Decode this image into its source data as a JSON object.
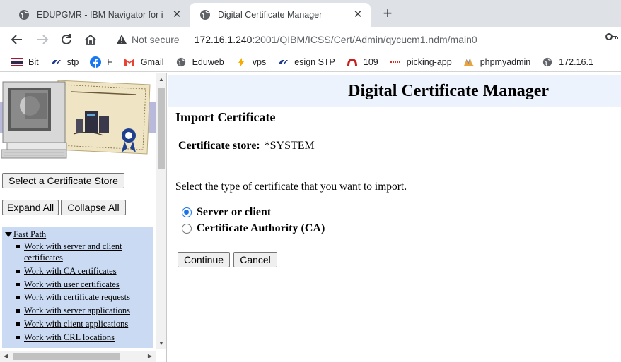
{
  "browser": {
    "tabs": [
      {
        "title": "EDUPGMR - IBM Navigator for i",
        "active": false
      },
      {
        "title": "Digital Certificate Manager",
        "active": true
      }
    ],
    "new_tab_symbol": "+",
    "close_symbol": "✕",
    "address": {
      "security_label": "Not secure",
      "host": "172.16.1.240",
      "path": ":2001/QIBM/ICSS/Cert/Admin/qycucm1.ndm/main0"
    },
    "bookmarks": [
      {
        "label": "Bit",
        "icon": "flag-icon"
      },
      {
        "label": "stp",
        "icon": "stp-icon"
      },
      {
        "label": "F",
        "icon": "facebook-icon"
      },
      {
        "label": "Gmail",
        "icon": "gmail-icon"
      },
      {
        "label": "Eduweb",
        "icon": "globe-icon"
      },
      {
        "label": "vps",
        "icon": "bolt-icon"
      },
      {
        "label": "esign STP",
        "icon": "stp-icon"
      },
      {
        "label": "109",
        "icon": "arch-icon"
      },
      {
        "label": "picking-app",
        "icon": "line-icon"
      },
      {
        "label": "phpmyadmin",
        "icon": "pma-icon"
      },
      {
        "label": "172.16.1",
        "icon": "globe-icon"
      }
    ]
  },
  "sidebar": {
    "select_store_label": "Select a Certificate Store",
    "expand_label": "Expand All",
    "collapse_label": "Collapse All",
    "tree_root": "Fast Path",
    "tree_items": [
      "Work with server and client certificates",
      "Work with CA certificates",
      "Work with user certificates",
      "Work with certificate requests",
      "Work with server applications",
      "Work with client applications",
      "Work with CRL locations"
    ]
  },
  "main": {
    "app_title": "Digital Certificate Manager",
    "heading": "Import Certificate",
    "store_label": "Certificate store:",
    "store_value": "*SYSTEM",
    "prompt": "Select the type of certificate that you want to import.",
    "options": [
      {
        "label": "Server or client",
        "selected": true
      },
      {
        "label": "Certificate Authority (CA)",
        "selected": false
      }
    ],
    "continue_label": "Continue",
    "cancel_label": "Cancel"
  },
  "colors": {
    "tabstrip": "#dee1e6",
    "header_bar": "#edf3fc",
    "tree_background": "#c9daf2",
    "radio_accent": "#1a73e8"
  }
}
